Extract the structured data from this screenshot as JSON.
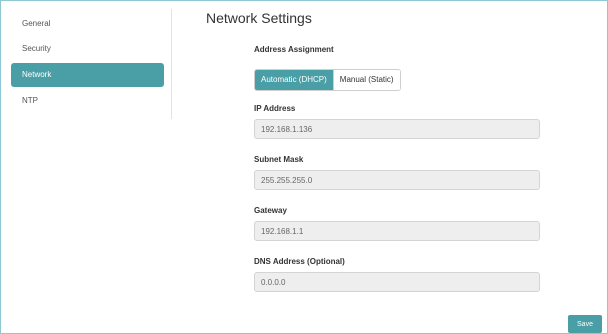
{
  "sidebar": {
    "items": [
      {
        "label": "General",
        "active": false
      },
      {
        "label": "Security",
        "active": false
      },
      {
        "label": "Network",
        "active": true
      },
      {
        "label": "NTP",
        "active": false
      }
    ]
  },
  "main": {
    "title": "Network Settings",
    "address_assignment": {
      "label": "Address Assignment",
      "options": [
        "Automatic (DHCP)",
        "Manual (Static)"
      ],
      "selected": "Automatic (DHCP)"
    },
    "fields": {
      "ip": {
        "label": "IP Address",
        "value": "192.168.1.136"
      },
      "subnet": {
        "label": "Subnet Mask",
        "value": "255.255.255.0"
      },
      "gateway": {
        "label": "Gateway",
        "value": "192.168.1.1"
      },
      "dns": {
        "label": "DNS Address (Optional)",
        "value": "0.0.0.0"
      }
    },
    "save_label": "Save"
  },
  "colors": {
    "accent": "#4a9ea6",
    "field_background": "#eeeeee",
    "frame_border": "#8fc7d6"
  }
}
